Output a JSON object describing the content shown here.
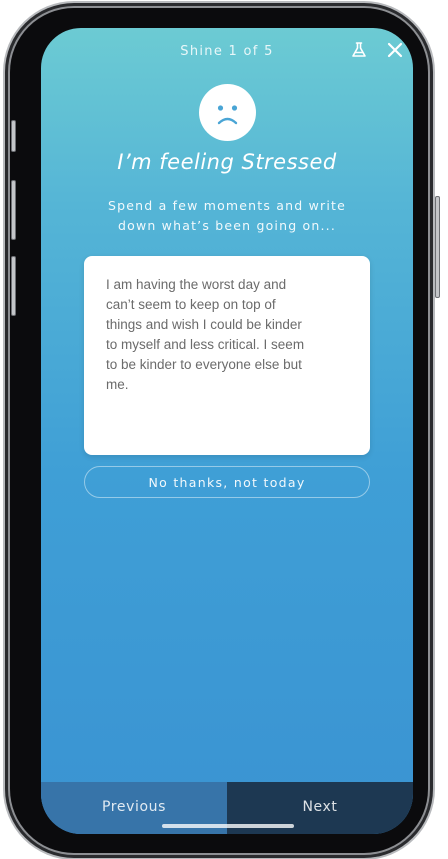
{
  "header": {
    "title": "Shine 1 of 5",
    "icons": [
      "flask-icon",
      "close-icon"
    ]
  },
  "mood": {
    "face_icon": "sad-face-icon",
    "title": "I’m feeling Stressed",
    "prompt_line_1": "Spend a few moments and write",
    "prompt_line_2": "down what’s been going on..."
  },
  "journal": {
    "lines": [
      "I am having the worst day and",
      "can’t seem to keep on top of",
      "things and wish I could be kinder",
      "to myself and less critical. I seem",
      "to be kinder to everyone else but",
      "me."
    ]
  },
  "actions": {
    "skip_label": "No thanks, not today"
  },
  "nav": {
    "previous_label": "Previous",
    "next_label": "Next"
  },
  "colors": {
    "gradient_top": "#6ccbd3",
    "gradient_bottom": "#3a93d2",
    "nav_previous": "#3774a9",
    "nav_next": "#1d3852"
  }
}
